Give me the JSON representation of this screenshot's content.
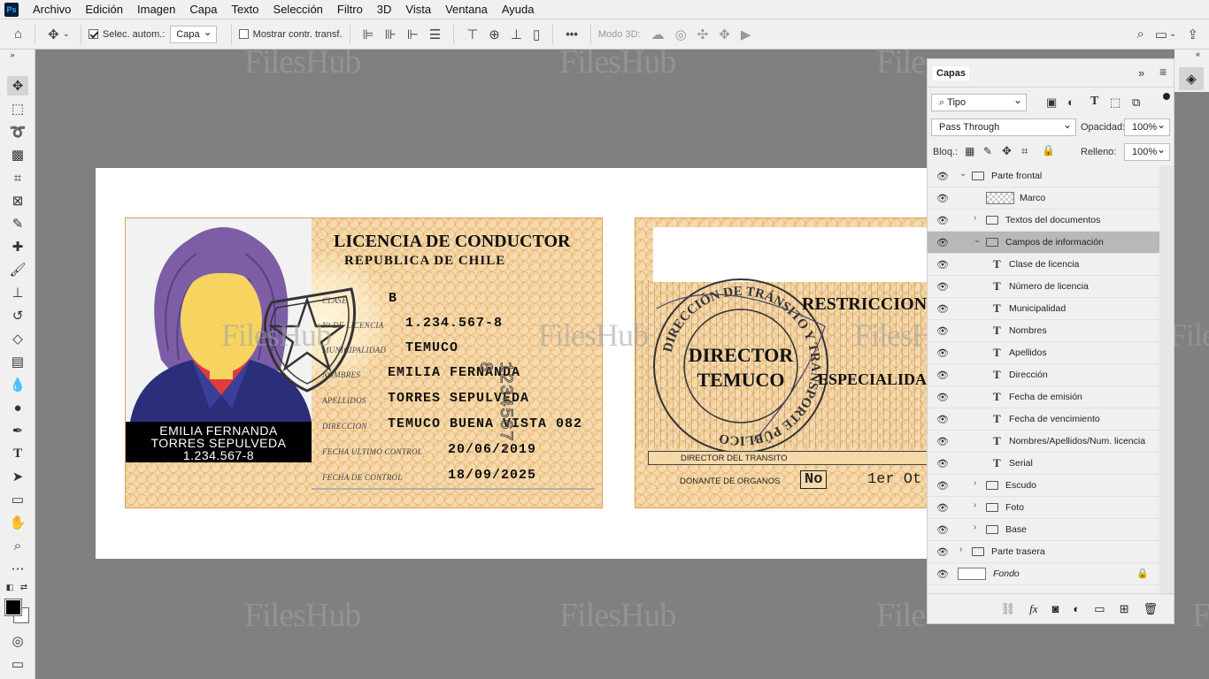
{
  "app": {
    "logo": "Ps"
  },
  "menu": [
    "Archivo",
    "Edición",
    "Imagen",
    "Capa",
    "Texto",
    "Selección",
    "Filtro",
    "3D",
    "Vista",
    "Ventana",
    "Ayuda"
  ],
  "options": {
    "auto_select_label": "Selec. autom.:",
    "auto_select_value": "Capa",
    "transform_label": "Mostrar contr. transf.",
    "mode3d_label": "Modo 3D:",
    "more": "•••"
  },
  "watermark": "FilesHub",
  "license_front": {
    "title": "LICENCIA DE CONDUCTOR",
    "subtitle": "REPUBLICA DE CHILE",
    "name_box": [
      "EMILIA FERNANDA",
      "TORRES SEPULVEDA",
      "1.234.567-8"
    ],
    "fields": [
      {
        "label": "CLASE",
        "value": "B"
      },
      {
        "label": "Nº DE LICENCIA",
        "value": "1.234.567-8"
      },
      {
        "label": "MUNICIPALIDAD",
        "value": "TEMUCO"
      },
      {
        "label": "NOMBRES",
        "value": "EMILIA FERNANDA"
      },
      {
        "label": "APELLIDOS",
        "value": "TORRES SEPULVEDA"
      },
      {
        "label": "DIRECCION",
        "value": "TEMUCO BUENA VISTA 082"
      },
      {
        "label": "FECHA ULTIMO CONTROL",
        "value": "20/06/2019"
      },
      {
        "label": "FECHA DE CONTROL",
        "value": "18/09/2025"
      }
    ],
    "serial": "1234567-8"
  },
  "license_back": {
    "seal_ring": "DIRECCIÓN DE TRÁNSITO Y TRANSPORTE PÚBLICO",
    "seal_line1": "DIRECTOR",
    "seal_line2": "TEMUCO",
    "restricciones": "RESTRICCION",
    "especialidad": "ESPECIALIDAD",
    "director_label": "DIRECTOR DEL TRANSITO",
    "donante_label": "DONANTE DE ORGANOS",
    "donante_value": "No",
    "partial": "1er Ot"
  },
  "layers_panel": {
    "tab": "Capas",
    "filter": "Tipo",
    "blend": "Pass Through",
    "opacity_label": "Opacidad:",
    "opacity": "100%",
    "lock_label": "Bloq.:",
    "fill_label": "Relleno:",
    "fill": "100%",
    "layers": [
      {
        "name": "Parte frontal",
        "kind": "group",
        "indent": 0,
        "open": true
      },
      {
        "name": "Marco",
        "kind": "smart",
        "indent": 1
      },
      {
        "name": "Textos del documentos",
        "kind": "group",
        "indent": 1,
        "open": false
      },
      {
        "name": "Campos de información",
        "kind": "group",
        "indent": 1,
        "open": true,
        "selected": true
      },
      {
        "name": "Clase de licencia",
        "kind": "text",
        "indent": 2
      },
      {
        "name": "Número de licencia",
        "kind": "text",
        "indent": 2
      },
      {
        "name": "Municipalidad",
        "kind": "text",
        "indent": 2
      },
      {
        "name": "Nombres",
        "kind": "text",
        "indent": 2
      },
      {
        "name": "Apellidos",
        "kind": "text",
        "indent": 2
      },
      {
        "name": "Dirección",
        "kind": "text",
        "indent": 2
      },
      {
        "name": "Fecha de emisión",
        "kind": "text",
        "indent": 2
      },
      {
        "name": "Fecha de vencimiento",
        "kind": "text",
        "indent": 2
      },
      {
        "name": "Nombres/Apellidos/Num. licencia",
        "kind": "text",
        "indent": 2
      },
      {
        "name": "Serial",
        "kind": "text",
        "indent": 2
      },
      {
        "name": "Escudo",
        "kind": "group",
        "indent": 1,
        "open": false
      },
      {
        "name": "Foto",
        "kind": "group",
        "indent": 1,
        "open": false
      },
      {
        "name": "Base",
        "kind": "group",
        "indent": 1,
        "open": false
      },
      {
        "name": "Parte trasera",
        "kind": "group",
        "indent": 0,
        "open": false
      },
      {
        "name": "Fondo",
        "kind": "background",
        "indent": 0
      }
    ]
  }
}
